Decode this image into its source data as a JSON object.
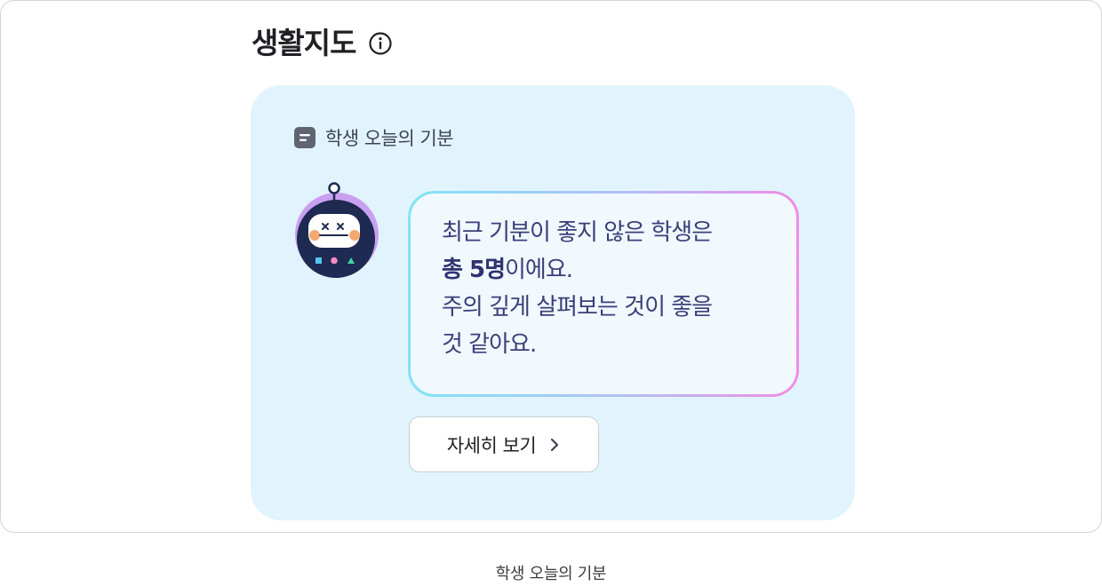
{
  "page_title": "생활지도",
  "card": {
    "header_label": "학생 오늘의 기분",
    "message": {
      "line1": "최근 기분이 좋지 않은 학생은",
      "line2_strong": "총 5명",
      "line2_rest": "이에요.",
      "line3": "주의 깊게 살펴보는 것이 좋을",
      "line4": "것 같아요."
    },
    "detail_button_label": "자세히 보기"
  },
  "caption": "학생 오늘의 기분",
  "colors": {
    "card_background": "#e1f4fd",
    "bubble_gradient_start": "#7fe5f3",
    "bubble_gradient_end": "#f18ce6",
    "text_accent": "#3b3f78",
    "robot_body": "#1e2a52",
    "robot_halo": "#c9a0f0"
  },
  "icons": {
    "title": "info-circle-icon",
    "header": "card-list-icon",
    "avatar": "robot-face-icon",
    "button": "chevron-right-icon"
  }
}
